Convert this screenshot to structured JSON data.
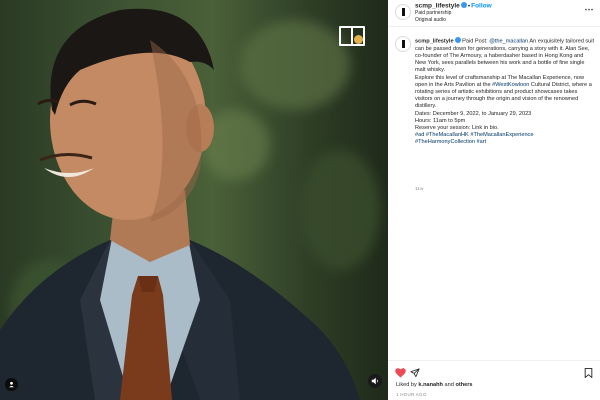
{
  "post": {
    "username": "scmp_lifestyle",
    "follow_label": "Follow",
    "paid_partnership": "Paid partnership",
    "audio": "Original audio"
  },
  "caption": {
    "username": "scmp_lifestyle",
    "paid_post_prefix": "Paid Post:",
    "partner_handle": "@the_macallan",
    "body": "An exquisitely tailored suit can be passed down for generations, carrying a story with it. Alan See, co-founder of The Armoury, a haberdasher based in Hong Kong and New York, sees parallels between his work and a bottle of fine single malt whisky.",
    "explore_before": "Explore this level of craftsmanship at The Macallan Experience, now open in the Arts Pavilion at the ",
    "explore_hashtag": "#WestKowloon",
    "explore_after": " Cultural District, where a rotating series of artistic exhibitions and product showcases takes visitors on a journey through the origin and vision of the renowned distillery.",
    "dates": "Dates: December 9, 2022, to January 29, 2023",
    "hours": "Hours: 11am to 5pm",
    "reserve": "Reserve your session: Link in bio.",
    "hashtags_line1": "#ad #TheMacallanHK #TheMacallanExperience",
    "hashtags_line2": "#TheHarmonyCollection #art",
    "time_ago": "11w"
  },
  "footer": {
    "liked_prefix": "Liked by",
    "liked_user": "k.nanahh",
    "liked_and": "and",
    "liked_others": "others",
    "posted": "1 hour ago"
  },
  "icons": {
    "heart": "heart-filled-icon",
    "share": "share-icon",
    "save": "bookmark-icon",
    "more": "more-icon",
    "tag": "user-tag-icon",
    "mute": "speaker-icon",
    "brand": "macallan-logo-icon"
  },
  "colors": {
    "like_red": "#ed4956",
    "link_blue": "#00376b",
    "follow_blue": "#0095f6",
    "verified_blue": "#3897f0"
  }
}
